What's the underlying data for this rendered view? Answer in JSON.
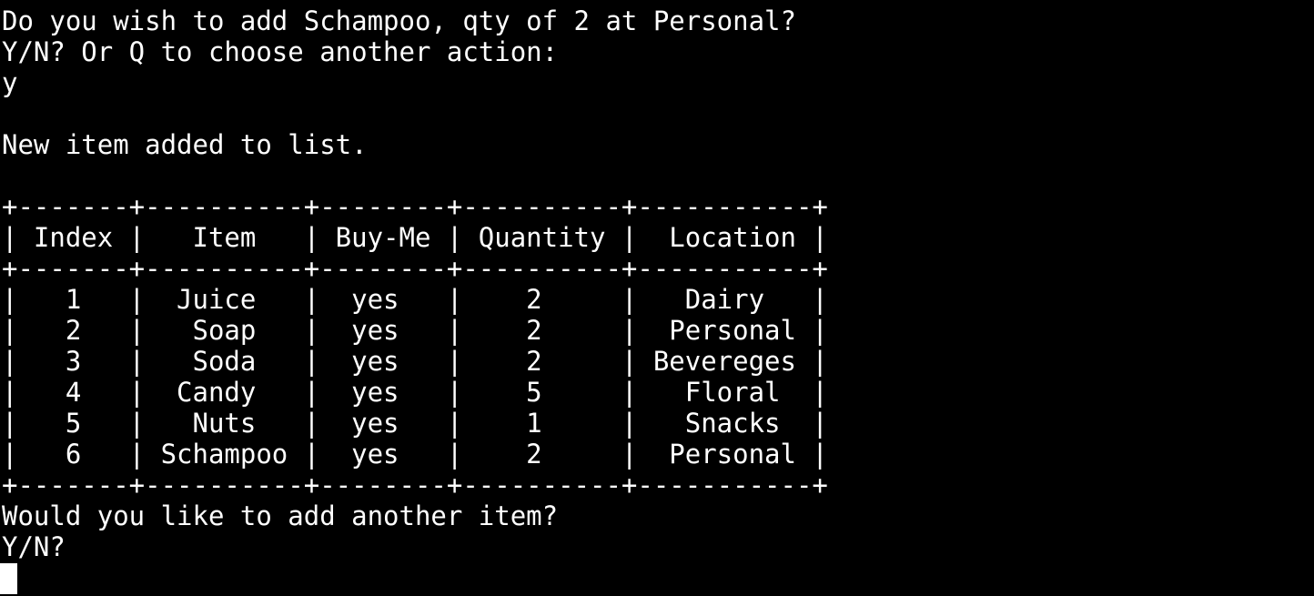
{
  "terminal": {
    "lines": [
      "Do you wish to add Schampoo, qty of 2 at Personal?",
      "Y/N? Or Q to choose another action:",
      "y",
      "",
      "New item added to list.",
      "",
      "+-------+----------+--------+----------+-----------+",
      "| Index |   Item   | Buy-Me | Quantity |  Location |",
      "+-------+----------+--------+----------+-----------+",
      "|   1   |  Juice   |  yes   |    2     |   Dairy   |",
      "|   2   |   Soap   |  yes   |    2     |  Personal |",
      "|   3   |   Soda   |  yes   |    2     | Bevereges |",
      "|   4   |  Candy   |  yes   |    5     |   Floral  |",
      "|   5   |   Nuts   |  yes   |    1     |   Snacks  |",
      "|   6   | Schampoo |  yes   |    2     |  Personal |",
      "+-------+----------+--------+----------+-----------+",
      "Would you like to add another item?",
      "Y/N?"
    ]
  },
  "colors": {
    "background": "#000000",
    "foreground": "#ffffff"
  }
}
